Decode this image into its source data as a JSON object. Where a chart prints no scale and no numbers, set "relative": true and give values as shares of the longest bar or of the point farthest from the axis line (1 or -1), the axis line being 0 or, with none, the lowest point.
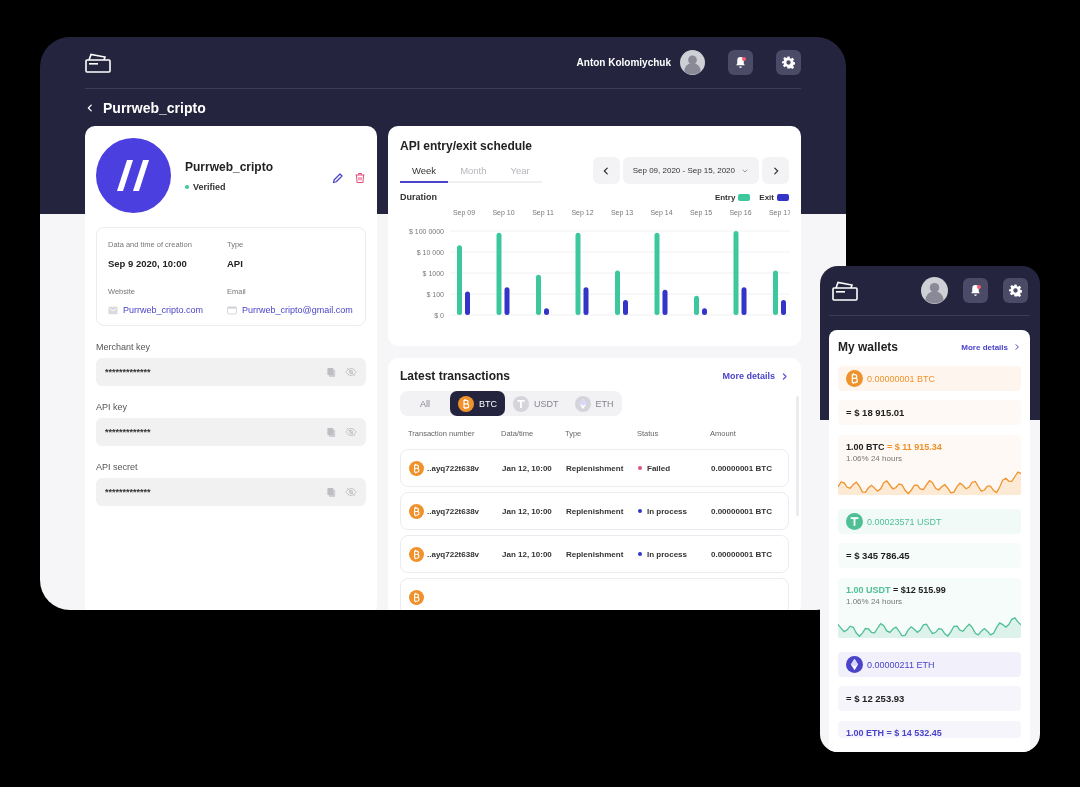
{
  "desktop": {
    "header": {
      "user_name": "Anton Kolomiychuk",
      "unread": true
    },
    "page_title": "Purrweb_cripto",
    "merchant": {
      "name": "Purrweb_cripto",
      "status": "Verified",
      "verified": true,
      "details": [
        {
          "label": "Data and time of creation",
          "value": "Sep 9 2020, 10:00",
          "kind": "text"
        },
        {
          "label": "Type",
          "value": "API",
          "kind": "text"
        },
        {
          "label": "Website",
          "value": "Purrweb_cripto.com",
          "kind": "website"
        },
        {
          "label": "Email",
          "value": "Purrweb_cripto@gmail.com",
          "kind": "email"
        }
      ],
      "keys": [
        {
          "label": "Merchant key",
          "value": "*************"
        },
        {
          "label": "API key",
          "value": "*************"
        },
        {
          "label": "API secret",
          "value": "*************"
        }
      ]
    },
    "schedule": {
      "title": "API entry/exit schedule",
      "tabs": [
        {
          "label": "Week",
          "selected": true
        },
        {
          "label": "Month",
          "selected": false
        },
        {
          "label": "Year",
          "selected": false
        }
      ],
      "date_range": "Sep 09, 2020 - Sep 15, 2020",
      "chart_data": {
        "type": "bar",
        "ylabel": "Duration",
        "categories": [
          "Sep 09",
          "Sep 10",
          "Sep 11",
          "Sep 12",
          "Sep 13",
          "Sep 14",
          "Sep 15",
          "Sep 16",
          "Sep 17"
        ],
        "series": [
          {
            "name": "Entry",
            "color": "#3cc79d",
            "values": [
              0.83,
              0.98,
              0.48,
              0.98,
              0.53,
              0.98,
              0.23,
              1,
              0.53
            ]
          },
          {
            "name": "Exit",
            "color": "#3434c8",
            "values": [
              0.28,
              0.33,
              0.08,
              0.33,
              0.18,
              0.3,
              0.08,
              0.33,
              0.18
            ]
          }
        ],
        "stacked": false,
        "relative": true
      },
      "y_axis_labels": [
        "$ 100 0000",
        "$ 10 000",
        "$ 1000",
        "$ 100",
        "$ 0"
      ]
    },
    "transactions": {
      "title": "Latest transactions",
      "more_link": "More details",
      "filters": [
        {
          "label": "All",
          "selected": false
        },
        {
          "label": "BTC",
          "kind": "btc",
          "selected": true
        },
        {
          "label": "USDT",
          "kind": "usdt",
          "selected": false
        },
        {
          "label": "ETH",
          "kind": "eth",
          "selected": false
        }
      ],
      "columns": [
        "Transaction number",
        "Data/time",
        "Type",
        "Status",
        "Amount"
      ],
      "rows": [
        {
          "kind": "btc",
          "number": "..ayq722t638v",
          "date": "Jan 12, 10:00",
          "type": "Replenishment",
          "status": "Failed",
          "color": "#e0507a",
          "amount": "0.00000001 BTC"
        },
        {
          "kind": "btc",
          "number": "..ayq722t638v",
          "date": "Jan 12, 10:00",
          "type": "Replenishment",
          "status": "In process",
          "color": "#3434c8",
          "amount": "0.00000001 BTC"
        },
        {
          "kind": "btc",
          "number": "..ayq722t638v",
          "date": "Jan 12, 10:00",
          "type": "Replenishment",
          "status": "In process",
          "color": "#3434c8",
          "amount": "0.00000001 BTC"
        },
        {
          "kind": "btc"
        }
      ]
    }
  },
  "mobile": {
    "header": {
      "unread": true
    },
    "title": "My wallets",
    "more_link": "More details",
    "wallets": [
      {
        "kind": "btc",
        "color": "#f0922b",
        "amount": "0.00000001 BTC",
        "usd": "= $ 18 915.01",
        "rate_base": "1.00 BTC",
        "rate_value": "= $ 11 915.34",
        "base_accent": false,
        "value_accent": true,
        "change": "1.06% 24 hours"
      },
      {
        "kind": "usdt",
        "color": "#4fbf95",
        "amount": "0.00023571 USDT",
        "usd": "= $ 345 786.45",
        "rate_base": "1.00 USDT",
        "rate_value": "= $12 515.99",
        "base_accent": true,
        "value_accent": false,
        "change": "1.06% 24 hours"
      },
      {
        "kind": "eth",
        "color": "#4a44c9",
        "amount": "0.00000211 ETH",
        "usd": "= $ 12 253.93",
        "rate_base": "1.00 ETH",
        "rate_value": "= $ 14 532.45",
        "base_accent": true,
        "value_accent": true
      }
    ]
  }
}
